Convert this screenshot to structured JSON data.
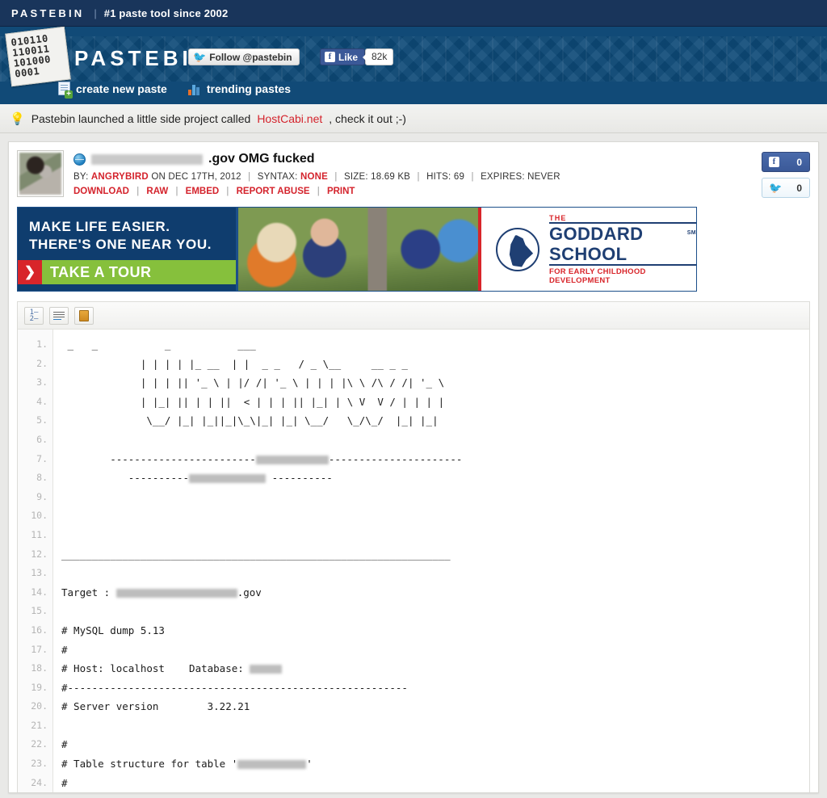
{
  "topbar": {
    "brand": "PASTEBIN",
    "separator": "|",
    "tagline": "#1 paste tool since 2002"
  },
  "header": {
    "logo_text": "PASTEBIN",
    "logo_bits": "010110\n110011\n101000\n0001",
    "follow_label": "Follow @pastebin",
    "facebook_like_label": "Like",
    "facebook_like_count": "82k",
    "nav": [
      {
        "label": "create new paste",
        "icon": "new-paste-icon"
      },
      {
        "label": "trending pastes",
        "icon": "trending-icon"
      }
    ]
  },
  "notice": {
    "icon": "lightbulb-icon",
    "text_before": "Pastebin launched a little side project called ",
    "link": "HostCabi.net",
    "text_after": ", check it out ;-)"
  },
  "paste": {
    "title_redacted": "██████ ████ ████",
    "title_suffix": ".gov OMG fucked",
    "meta": {
      "by_label": "BY:",
      "author": "ANGRYBIRD",
      "on_text": "ON DEC 17TH, 2012",
      "syntax_label": "SYNTAX:",
      "syntax_value": "NONE",
      "size_label": "SIZE:",
      "size_value": "18.69 KB",
      "hits_label": "HITS:",
      "hits_value": "69",
      "expires_label": "EXPIRES:",
      "expires_value": "NEVER"
    },
    "actions": [
      "DOWNLOAD",
      "RAW",
      "EMBED",
      "REPORT ABUSE",
      "PRINT"
    ],
    "social": {
      "facebook_count": "0",
      "twitter_count": "0"
    }
  },
  "ad": {
    "line1": "MAKE LIFE EASIER.",
    "line2": "THERE'S ONE NEAR YOU.",
    "cta": "TAKE A TOUR",
    "cta_icon": "chevron-right-icon",
    "brand_the": "THE",
    "brand_main": "GODDARD SCHOOL",
    "brand_sm": "SM",
    "brand_sub": "FOR EARLY CHILDHOOD DEVELOPMENT"
  },
  "toolbar": {
    "buttons": [
      {
        "name": "toggle-line-numbers",
        "icon": "numbered-list-icon"
      },
      {
        "name": "toggle-word-wrap",
        "icon": "text-wrap-icon"
      },
      {
        "name": "copy-to-clipboard",
        "icon": "clipboard-icon"
      }
    ]
  },
  "code": {
    "line_numbers": [
      "1.",
      "2.",
      "3.",
      "4.",
      "5.",
      "6.",
      "7.",
      "8.",
      "9.",
      "10.",
      "11.",
      "12.",
      "13.",
      "14.",
      "15.",
      "16.",
      "17.",
      "18.",
      "19.",
      "20.",
      "21.",
      "22.",
      "23.",
      "24."
    ],
    "lines": [
      {
        "text": " _   _           _           ___"
      },
      {
        "text": "             | | | | |_ __  | |  _ _   / _ \\__     __ _ _"
      },
      {
        "text": "             | | | || '_ \\ | |/ /| '_ \\ | | | |\\ \\ /\\ / /| '_ \\"
      },
      {
        "text": "             | |_| || | | ||  < | | | || |_| | \\ V  V / | | | |"
      },
      {
        "text": "              \\__/ |_| |_||_|\\_\\|_| |_| \\__/   \\_/\\_/  |_| |_|"
      },
      {
        "text": ""
      },
      {
        "text": "        ------------------------",
        "redact": "w1",
        "text_after": "----------------------"
      },
      {
        "text": "           ----------",
        "redact": "w2",
        "text_after": " ----------"
      },
      {
        "text": ""
      },
      {
        "text": ""
      },
      {
        "text": ""
      },
      {
        "text": "________________________________________________________________"
      },
      {
        "text": ""
      },
      {
        "text": "Target : ",
        "redact": "w3",
        "text_after": ".gov"
      },
      {
        "text": ""
      },
      {
        "text": "# MySQL dump 5.13"
      },
      {
        "text": "#"
      },
      {
        "text": "# Host: localhost    Database: ",
        "redact": "w4",
        "text_after": ""
      },
      {
        "text": "#--------------------------------------------------------"
      },
      {
        "text": "# Server version        3.22.21"
      },
      {
        "text": ""
      },
      {
        "text": "#"
      },
      {
        "text": "# Table structure for table '",
        "redact": "w5",
        "text_after": "'"
      },
      {
        "text": "#"
      }
    ]
  },
  "colors": {
    "topbar_navy": "#19355b",
    "header_blue": "#114a77",
    "link_red": "#d4232c",
    "facebook_blue": "#3b5998",
    "twitter_blue": "#3aa3dd",
    "ad_navy": "#0f3d6e",
    "ad_green": "#86c03c",
    "ad_red": "#d8252a",
    "goddard_blue": "#1f3f73"
  }
}
